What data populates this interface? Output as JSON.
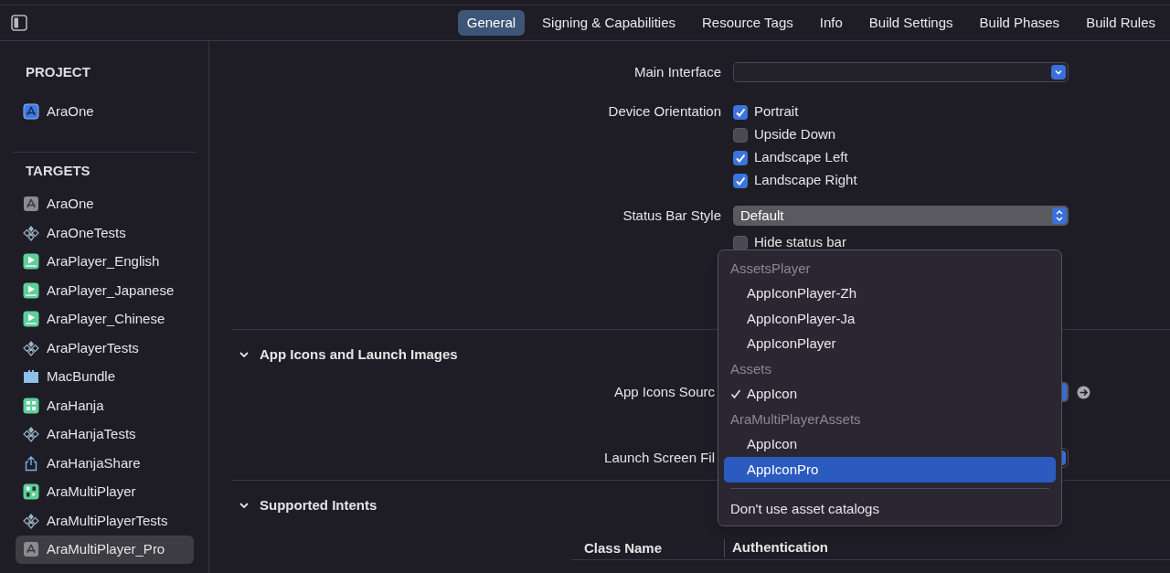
{
  "toolbar": {
    "tabs": [
      {
        "label": "General",
        "selected": true
      },
      {
        "label": "Signing & Capabilities",
        "selected": false
      },
      {
        "label": "Resource Tags",
        "selected": false
      },
      {
        "label": "Info",
        "selected": false
      },
      {
        "label": "Build Settings",
        "selected": false
      },
      {
        "label": "Build Phases",
        "selected": false
      },
      {
        "label": "Build Rules",
        "selected": false
      }
    ]
  },
  "sidebar": {
    "sections": [
      {
        "title": "PROJECT",
        "items": [
          {
            "label": "AraOne",
            "kind": "project",
            "selected": false
          }
        ]
      },
      {
        "title": "TARGETS",
        "items": [
          {
            "label": "AraOne",
            "kind": "app",
            "selected": false
          },
          {
            "label": "AraOneTests",
            "kind": "tests",
            "selected": false
          },
          {
            "label": "AraPlayer_English",
            "kind": "player",
            "selected": false
          },
          {
            "label": "AraPlayer_Japanese",
            "kind": "player",
            "selected": false
          },
          {
            "label": "AraPlayer_Chinese",
            "kind": "player",
            "selected": false
          },
          {
            "label": "AraPlayerTests",
            "kind": "tests",
            "selected": false
          },
          {
            "label": "MacBundle",
            "kind": "bundle",
            "selected": false
          },
          {
            "label": "AraHanja",
            "kind": "hanja",
            "selected": false
          },
          {
            "label": "AraHanjaTests",
            "kind": "tests",
            "selected": false
          },
          {
            "label": "AraHanjaShare",
            "kind": "share",
            "selected": false
          },
          {
            "label": "AraMultiPlayer",
            "kind": "multiplayer",
            "selected": false
          },
          {
            "label": "AraMultiPlayerTests",
            "kind": "tests",
            "selected": false
          },
          {
            "label": "AraMultiPlayer_Pro",
            "kind": "app",
            "selected": true
          }
        ]
      }
    ]
  },
  "deployment_info": {
    "main_interface": {
      "label": "Main Interface"
    },
    "device_orientation": {
      "label": "Device Orientation",
      "options": [
        {
          "label": "Portrait",
          "checked": true
        },
        {
          "label": "Upside Down",
          "checked": false
        },
        {
          "label": "Landscape Left",
          "checked": true
        },
        {
          "label": "Landscape Right",
          "checked": true
        }
      ]
    },
    "status_bar_style": {
      "label": "Status Bar Style",
      "value": "Default"
    },
    "hide_status_bar": {
      "label": "Hide status bar",
      "checked": false
    }
  },
  "sections": [
    {
      "title": "App Icons and Launch Images",
      "expanded": true
    },
    {
      "title": "Supported Intents",
      "expanded": true
    }
  ],
  "app_icons": {
    "app_icons_source_label": "App Icons Sourc",
    "launch_screen_file_label": "Launch Screen Fil"
  },
  "intents_table": {
    "columns": [
      "Class Name",
      "Authentication"
    ]
  },
  "menu": {
    "groups": [
      {
        "title": "AssetsPlayer",
        "items": [
          {
            "label": "AppIconPlayer-Zh",
            "checked": false,
            "selected": false
          },
          {
            "label": "AppIconPlayer-Ja",
            "checked": false,
            "selected": false
          },
          {
            "label": "AppIconPlayer",
            "checked": false,
            "selected": false
          }
        ]
      },
      {
        "title": "Assets",
        "items": [
          {
            "label": "AppIcon",
            "checked": true,
            "selected": false
          }
        ]
      },
      {
        "title": "AraMultiPlayerAssets",
        "items": [
          {
            "label": "AppIcon",
            "checked": false,
            "selected": false
          },
          {
            "label": "AppIconPro",
            "checked": false,
            "selected": true
          }
        ]
      }
    ],
    "footer": "Don't use asset catalogs"
  }
}
